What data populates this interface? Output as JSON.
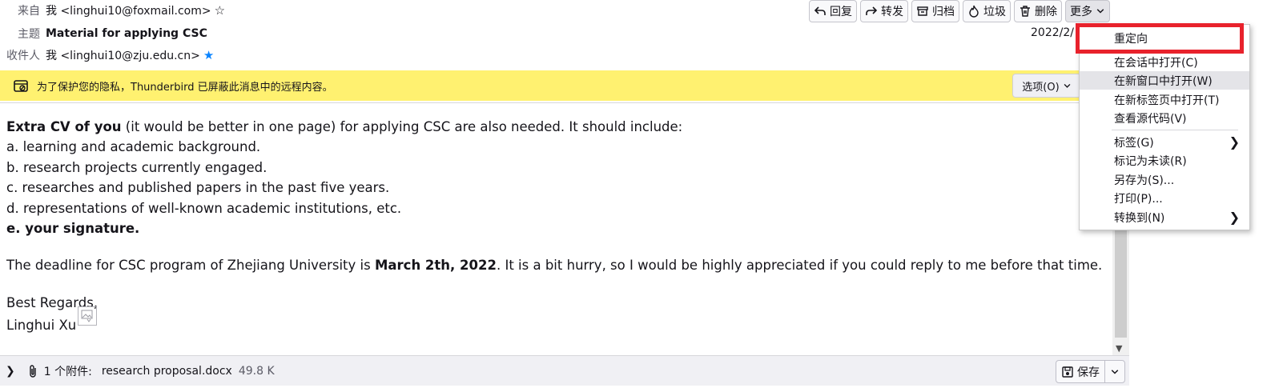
{
  "header": {
    "from_label": "来自",
    "from_value": "我 <linghui10@foxmail.com>",
    "subject_label": "主题",
    "subject_value": "Material for applying CSC",
    "to_label": "收件人",
    "to_value": "我 <linghui10@zju.edu.cn>",
    "date": "2022/2/"
  },
  "toolbar": {
    "reply": "回复",
    "forward": "转发",
    "archive": "归档",
    "junk": "垃圾",
    "delete": "删除",
    "more": "更多"
  },
  "notice": {
    "text": "为了保护您的隐私，Thunderbird 已屏蔽此消息中的远程内容。",
    "options_button": "选项(O)"
  },
  "body": {
    "line1_bold": "Extra CV of you",
    "line1_rest": " (it would be better in one page) for applying CSC are also needed. It should include:",
    "item_a": "a. learning and academic background.",
    "item_b": "b. research projects currently engaged.",
    "item_c": "c. researches and published papers in the past five years.",
    "item_d": "d. representations of well-known academic institutions, etc.",
    "item_e": "e. your signature.",
    "deadline_pre": "The deadline for CSC program of Zhejiang University is ",
    "deadline_bold": "March 2th, 2022",
    "deadline_post": ". It is a bit hurry, so I would be highly appreciated if you could reply to me before that time.",
    "regards": "Best Regards,",
    "signature": "Linghui Xu"
  },
  "attachment": {
    "count": "1 个附件:",
    "name": "research proposal.docx",
    "size": "49.8 K",
    "save": "保存"
  },
  "menu": {
    "items": [
      "重定向",
      "在会话中打开(C)",
      "在新窗口中打开(W)",
      "在新标签页中打开(T)",
      "查看源代码(V)",
      "标签(G)",
      "标记为未读(R)",
      "另存为(S)...",
      "打印(P)...",
      "转换到(N)"
    ]
  },
  "colors": {
    "notice_bg": "#fff170",
    "highlight": "#e8222c",
    "recipient_star": "#0a84ff"
  }
}
